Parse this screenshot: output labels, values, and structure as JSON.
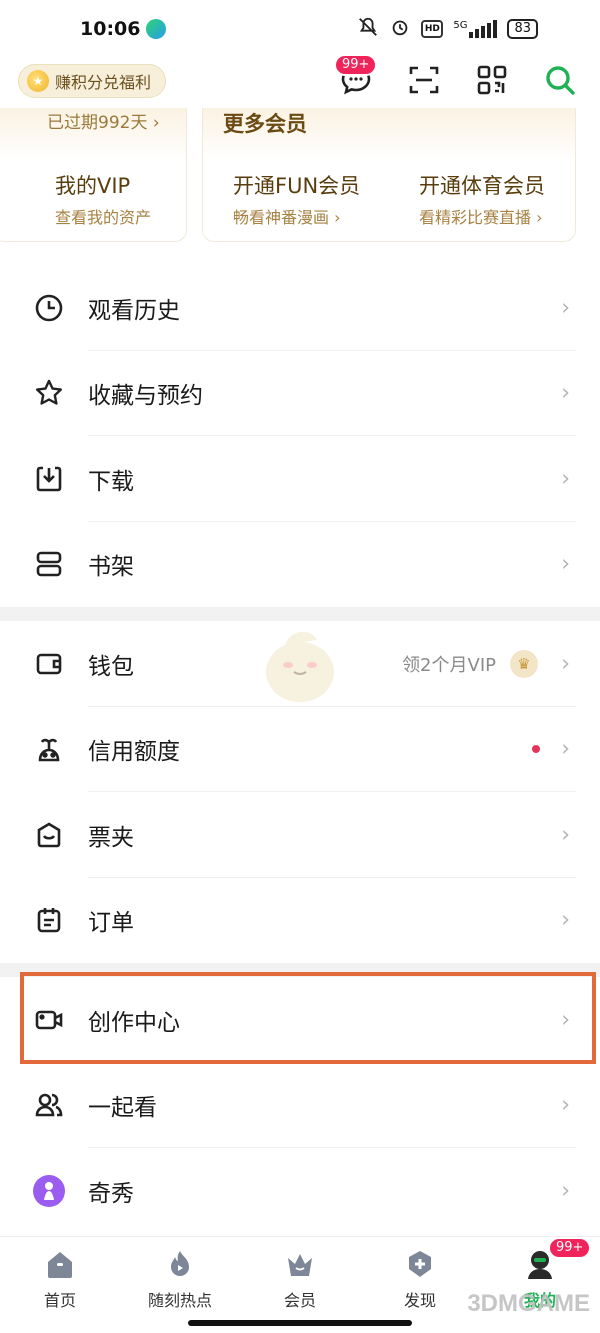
{
  "status": {
    "time": "10:06",
    "network": "5G",
    "hd": "HD",
    "battery": "83"
  },
  "topbar": {
    "earn_label": "赚积分兑福利",
    "message_badge": "99+"
  },
  "vip": {
    "expired_text": "已过期992天 ›",
    "my_vip_title": "我的VIP",
    "my_vip_sub": "查看我的资产",
    "more_title": "更多会员",
    "fun_title": "开通FUN会员",
    "fun_sub": "畅看神番漫画 ›",
    "sports_title": "开通体育会员",
    "sports_sub": "看精彩比赛直播 ›"
  },
  "menu_group1": [
    {
      "label": "观看历史",
      "icon": "clock-icon"
    },
    {
      "label": "收藏与预约",
      "icon": "star-icon"
    },
    {
      "label": "下载",
      "icon": "download-icon"
    },
    {
      "label": "书架",
      "icon": "bookshelf-icon"
    }
  ],
  "menu_group2": [
    {
      "label": "钱包",
      "icon": "wallet-icon",
      "extra": "领2个月VIP"
    },
    {
      "label": "信用额度",
      "icon": "credit-icon"
    },
    {
      "label": "票夹",
      "icon": "ticket-icon"
    },
    {
      "label": "订单",
      "icon": "order-icon"
    }
  ],
  "menu_group3": [
    {
      "label": "创作中心",
      "icon": "camera-icon"
    },
    {
      "label": "一起看",
      "icon": "people-icon"
    },
    {
      "label": "奇秀",
      "icon": "qixiu-icon"
    }
  ],
  "tabs": [
    {
      "label": "首页"
    },
    {
      "label": "随刻热点"
    },
    {
      "label": "会员"
    },
    {
      "label": "发现"
    },
    {
      "label": "我的",
      "badge": "99+"
    }
  ],
  "watermark": "3DMGAME",
  "colors": {
    "accent_green": "#1fb255",
    "highlight_orange": "#e2693a",
    "badge_red": "#f0245a"
  }
}
